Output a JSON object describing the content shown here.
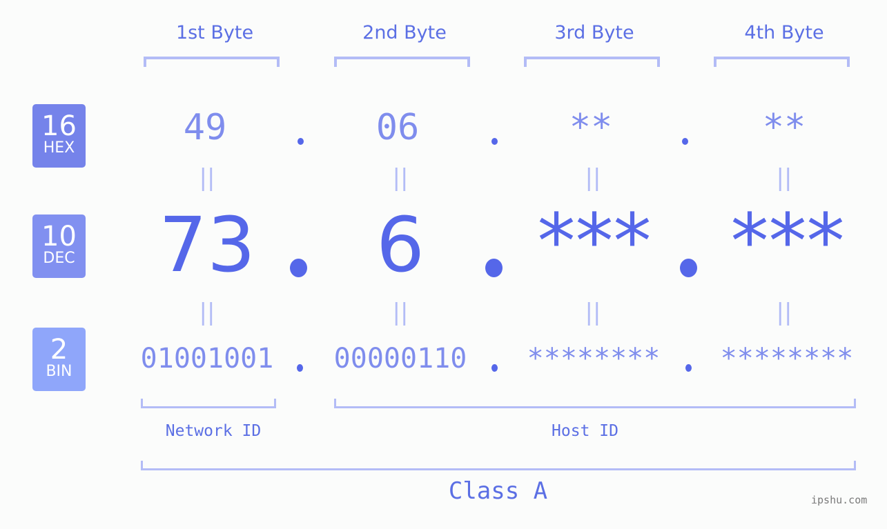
{
  "badges": [
    {
      "number": "16",
      "label": "HEX",
      "color": "#7583ea"
    },
    {
      "number": "10",
      "label": "DEC",
      "color": "#8190f0"
    },
    {
      "number": "2",
      "label": "BIN",
      "color": "#8fa6fa"
    }
  ],
  "bytes": [
    {
      "header": "1st Byte",
      "hex": "49",
      "dec": "73",
      "bin": "01001001"
    },
    {
      "header": "2nd Byte",
      "hex": "06",
      "dec": "6",
      "bin": "00000110"
    },
    {
      "header": "3rd Byte",
      "hex": "**",
      "dec": "***",
      "bin": "********"
    },
    {
      "header": "4th Byte",
      "hex": "**",
      "dec": "***",
      "bin": "********"
    }
  ],
  "equals_glyph": "||",
  "network_id_label": "Network ID",
  "host_id_label": "Host ID",
  "class_label": "Class A",
  "watermark": "ipshu.com",
  "colors": {
    "accent": "#5567e9",
    "light_accent": "#7f8ded",
    "bracket": "#b3bcf6"
  }
}
